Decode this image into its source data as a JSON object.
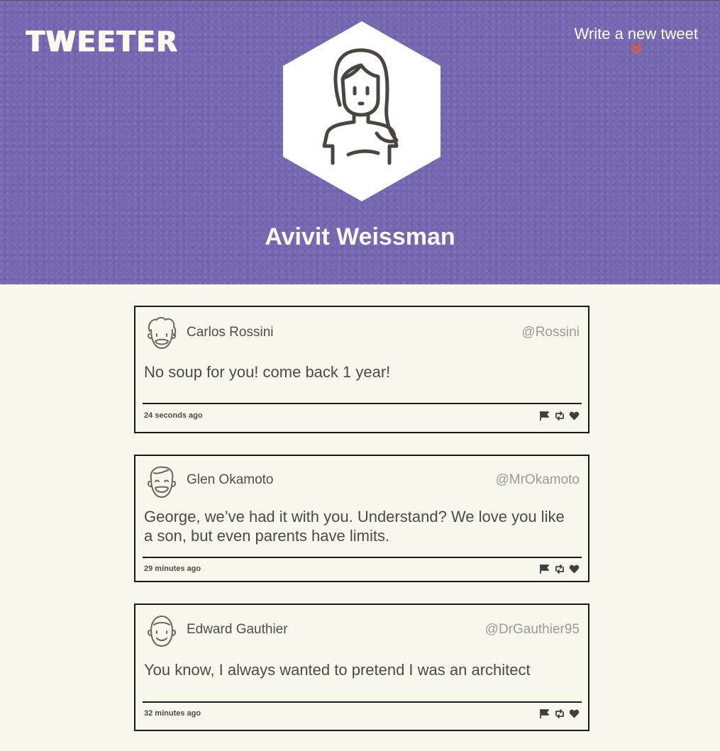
{
  "brand": {
    "logo": "TWEETER",
    "color": "#7466b0"
  },
  "header": {
    "compose_label": "Write a new tweet",
    "compose_icon": "double-chevron-down-icon",
    "profile_name": "Avivit Weissman",
    "profile_avatar": "woman-avatar-icon"
  },
  "tweets": [
    {
      "name": "Carlos Rossini",
      "handle": "@Rossini",
      "avatar": "curly-hair-man-avatar-icon",
      "text": "No soup for you! come back 1 year!",
      "time": "24 seconds ago",
      "actions": [
        "flag-icon",
        "retweet-icon",
        "heart-icon"
      ]
    },
    {
      "name": "Glen Okamoto",
      "handle": "@MrOkamoto",
      "avatar": "smiling-man-avatar-icon",
      "text": "George, we’ve had it with you. Understand? We love you like a son, but even parents have limits.",
      "time": "29 minutes ago",
      "actions": [
        "flag-icon",
        "retweet-icon",
        "heart-icon"
      ]
    },
    {
      "name": "Edward Gauthier",
      "handle": "@DrGauthier95",
      "avatar": "bald-man-avatar-icon",
      "text": "You know, I always wanted to pretend I was an architect",
      "time": "32 minutes ago",
      "actions": [
        "flag-icon",
        "retweet-icon",
        "heart-icon"
      ]
    }
  ],
  "accent_color": "#e0593e"
}
